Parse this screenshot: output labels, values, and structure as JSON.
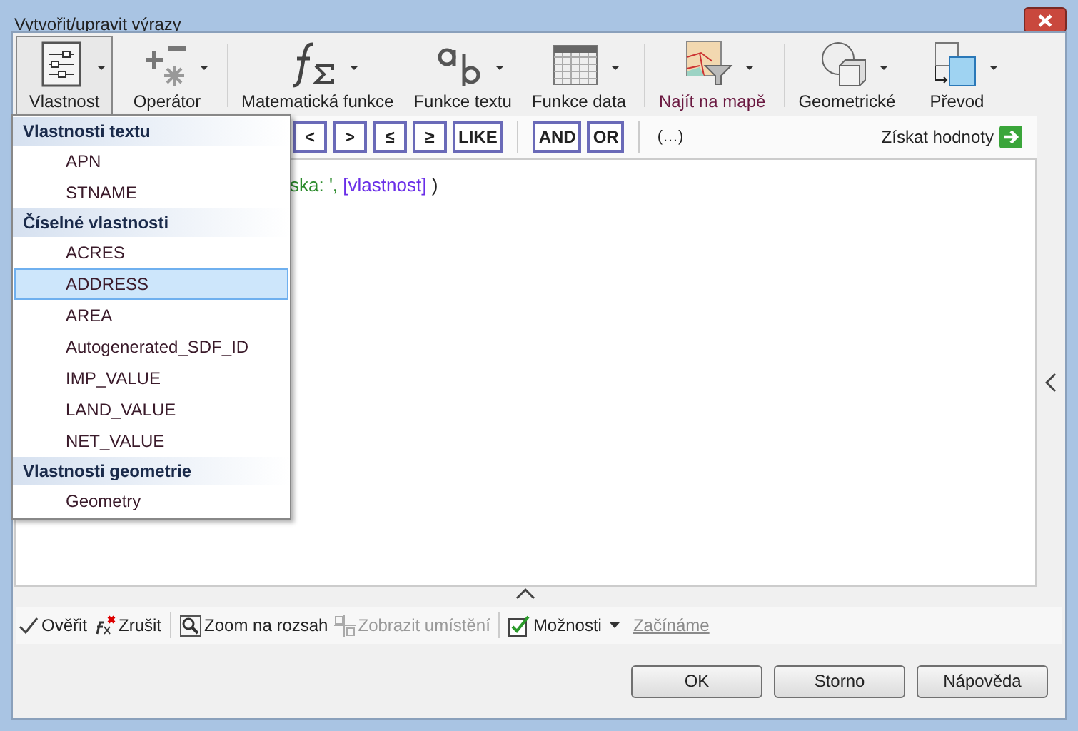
{
  "window": {
    "title": "Vytvořit/upravit výrazy"
  },
  "ribbon": [
    {
      "kind": "sliders",
      "label": "Vlastnost",
      "open": true
    },
    {
      "kind": "operator",
      "label": "Operátor",
      "open": false
    },
    {
      "kind": "math",
      "label": "Matematická funkce",
      "open": false
    },
    {
      "kind": "text",
      "label": "Funkce textu",
      "open": false
    },
    {
      "kind": "calendar",
      "label": "Funkce data",
      "open": false
    },
    {
      "kind": "map",
      "label": "Najít na mapě",
      "open": false
    },
    {
      "kind": "geometry",
      "label": "Geometrické",
      "open": false
    },
    {
      "kind": "convert",
      "label": "Převod",
      "open": false
    }
  ],
  "operators": [
    {
      "label": "<",
      "kind": "compare"
    },
    {
      "label": ">",
      "kind": "compare"
    },
    {
      "label": "≤",
      "kind": "compare"
    },
    {
      "label": "≥",
      "kind": "compare"
    },
    {
      "label": "LIKE",
      "kind": "compare"
    },
    {
      "label": "AND",
      "kind": "logic"
    },
    {
      "label": "OR",
      "kind": "logic"
    },
    {
      "label": "(…)",
      "kind": "group"
    }
  ],
  "get_values": {
    "label": "Získat hodnoty"
  },
  "expression": [
    {
      "kind": "string",
      "text": "ska: ',"
    },
    {
      "kind": "field",
      "text": "[vlastnost]"
    },
    {
      "kind": "plain",
      "text": ")"
    }
  ],
  "menu": [
    {
      "kind": "header",
      "label": "Vlastnosti textu"
    },
    {
      "kind": "item",
      "label": "APN",
      "selected": false
    },
    {
      "kind": "item",
      "label": "STNAME",
      "selected": false
    },
    {
      "kind": "header",
      "label": "Číselné vlastnosti"
    },
    {
      "kind": "item",
      "label": "ACRES",
      "selected": false
    },
    {
      "kind": "item",
      "label": "ADDRESS",
      "selected": true
    },
    {
      "kind": "item",
      "label": "AREA",
      "selected": false
    },
    {
      "kind": "item",
      "label": "Autogenerated_SDF_ID",
      "selected": false
    },
    {
      "kind": "item",
      "label": "IMP_VALUE",
      "selected": false
    },
    {
      "kind": "item",
      "label": "LAND_VALUE",
      "selected": false
    },
    {
      "kind": "item",
      "label": "NET_VALUE",
      "selected": false
    },
    {
      "kind": "header",
      "label": "Vlastnosti geometrie"
    },
    {
      "kind": "item",
      "label": "Geometry",
      "selected": false
    }
  ],
  "bottom_toolbar": [
    {
      "kind": "check",
      "label": "Ověřit",
      "disabled": false
    },
    {
      "kind": "clear",
      "label": "Zrušit",
      "disabled": false
    },
    {
      "kind": "zoom",
      "label": "Zoom na rozsah",
      "disabled": false
    },
    {
      "kind": "locate",
      "label": "Zobrazit umístění",
      "disabled": true
    },
    {
      "kind": "options",
      "label": "Možnosti",
      "disabled": false
    },
    {
      "kind": "link",
      "label": "Začínáme",
      "disabled": true
    }
  ],
  "buttons": [
    "OK",
    "Storno",
    "Nápověda"
  ]
}
